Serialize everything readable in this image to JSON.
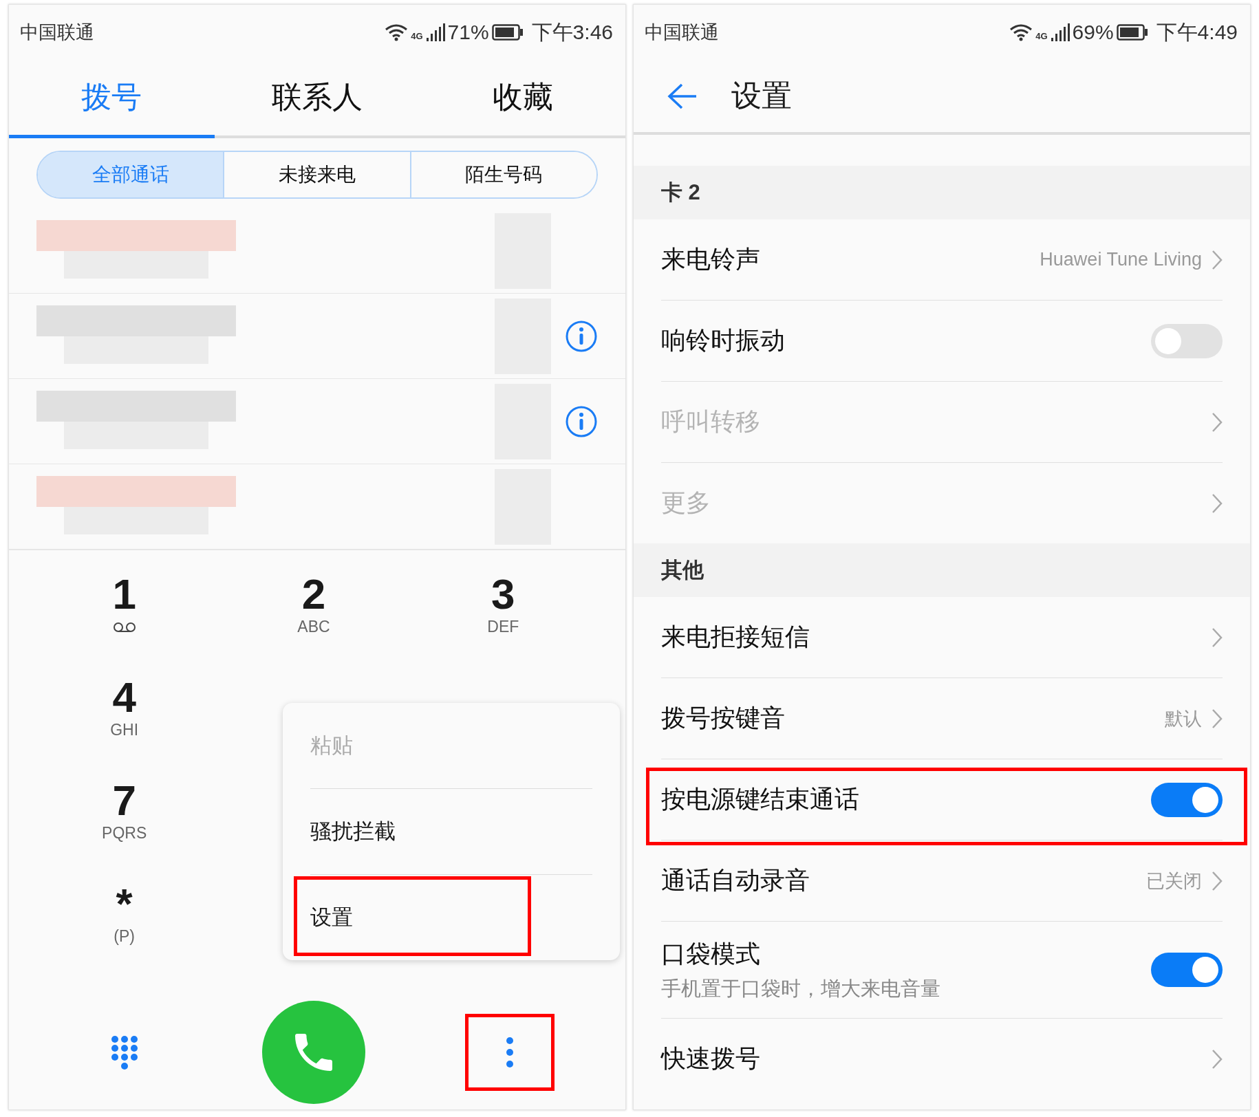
{
  "left_screen": {
    "status_bar": {
      "carrier": "中国联通",
      "network": "4G",
      "battery": "71%",
      "time": "下午3:46"
    },
    "tabs": [
      {
        "label": "拨号",
        "selected": true
      },
      {
        "label": "联系人",
        "selected": false
      },
      {
        "label": "收藏",
        "selected": false
      }
    ],
    "filters": [
      {
        "label": "全部通话",
        "selected": true
      },
      {
        "label": "未接来电",
        "selected": false
      },
      {
        "label": "陌生号码",
        "selected": false
      }
    ],
    "keypad": [
      [
        {
          "digit": "1",
          "kind": "voicemail"
        },
        {
          "digit": "2",
          "kind": "letters",
          "letters": "ABC"
        },
        {
          "digit": "3",
          "kind": "letters",
          "letters": "DEF"
        }
      ],
      [
        {
          "digit": "4",
          "kind": "letters",
          "letters": "GHI"
        }
      ],
      [
        {
          "digit": "7",
          "kind": "letters",
          "letters": "PQRS"
        }
      ],
      [
        {
          "digit": "*",
          "kind": "letters",
          "letters": "(P)"
        }
      ]
    ],
    "menu": [
      {
        "label": "粘贴",
        "disabled": true,
        "highlighted": false
      },
      {
        "label": "骚扰拦截",
        "disabled": false,
        "highlighted": false
      },
      {
        "label": "设置",
        "disabled": false,
        "highlighted": true
      }
    ],
    "more_button": {
      "highlighted": true
    }
  },
  "right_screen": {
    "status_bar": {
      "carrier": "中国联通",
      "network": "4G",
      "battery": "69%",
      "time": "下午4:49"
    },
    "title": "设置",
    "sections": [
      {
        "header": "卡 2",
        "rows": [
          {
            "kind": "link",
            "label": "来电铃声",
            "value": "Huawei Tune Living",
            "disabled": false,
            "highlighted": false
          },
          {
            "kind": "toggle",
            "label": "响铃时振动",
            "on": false,
            "disabled": false,
            "highlighted": false
          },
          {
            "kind": "link",
            "label": "呼叫转移",
            "disabled": true,
            "highlighted": false
          },
          {
            "kind": "link",
            "label": "更多",
            "disabled": true,
            "highlighted": false
          }
        ]
      },
      {
        "header": "其他",
        "rows": [
          {
            "kind": "link",
            "label": "来电拒接短信",
            "disabled": false,
            "highlighted": false
          },
          {
            "kind": "link",
            "label": "拨号按键音",
            "value": "默认",
            "disabled": false,
            "highlighted": false
          },
          {
            "kind": "toggle",
            "label": "按电源键结束通话",
            "on": true,
            "disabled": false,
            "highlighted": true
          },
          {
            "kind": "link",
            "label": "通话自动录音",
            "value": "已关闭",
            "disabled": false,
            "highlighted": false
          },
          {
            "kind": "toggle",
            "label": "口袋模式",
            "subtitle": "手机置于口袋时，增大来电音量",
            "on": true,
            "disabled": false,
            "highlighted": false
          },
          {
            "kind": "link",
            "label": "快速拨号",
            "disabled": false,
            "highlighted": false
          }
        ]
      }
    ]
  }
}
